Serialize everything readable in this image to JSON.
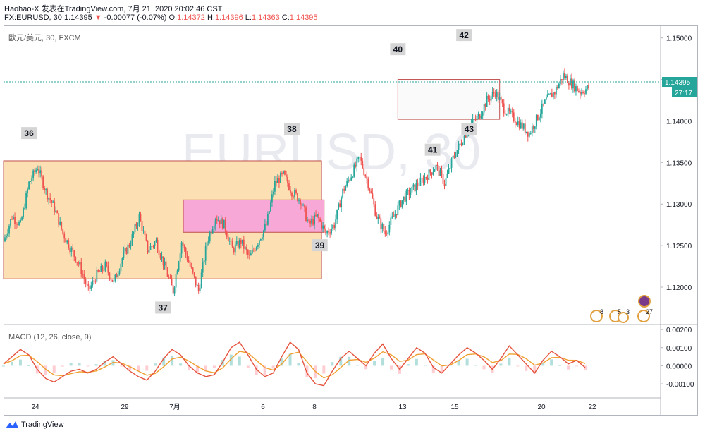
{
  "header": {
    "line1": "Haohao-X 发表在TradingView.com, 7月 21, 2020 20:02:46 CST",
    "symbol_line": "FX:EURUSD, 30 1.14395",
    "change_arrow": "▼",
    "change": "-0.00077 (-0.07%)",
    "o_label": "O:",
    "o_value": "1.14372",
    "h_label": "H:",
    "h_value": "1.14396",
    "l_label": "L:",
    "l_value": "1.14363",
    "c_label": "C:",
    "c_value": "1.14395"
  },
  "pane_symbol": "欧元/美元, 30, FXCM",
  "watermark": "EURUSD, 30",
  "macd_label": "MACD (12, 26, close, 9)",
  "brand": "TradingView",
  "price_badge": "1.14395",
  "timer_badge": "27:17",
  "event_badges": [
    "8",
    "5",
    "3",
    "27"
  ],
  "colors": {
    "up": "#26a69a",
    "down": "#ef5350",
    "zone_orange": "#fddfb4",
    "zone_pink": "#f7a8d6",
    "zone_box": "#fafafa",
    "zone_border": "#c0504d",
    "macd_line": "#e5533d",
    "signal_line": "#f0a030",
    "price_line": "#26a69a"
  },
  "chart_data": [
    {
      "type": "candlestick",
      "title": "",
      "x_ticks": [
        "24",
        "29",
        "7月",
        "6",
        "8",
        "13",
        "15",
        "20",
        "22"
      ],
      "y_ticks": [
        1.15,
        1.145,
        1.14,
        1.135,
        1.13,
        1.125,
        1.12
      ],
      "y_tick_labels": [
        "1.15000",
        "1.14500",
        "1.14000",
        "1.13500",
        "1.13000",
        "1.12500",
        "1.12000"
      ],
      "ylim": [
        1.1155,
        1.1515
      ],
      "last_price": 1.14395,
      "price_path": [
        [
          0,
          1.1255
        ],
        [
          1,
          1.1285
        ],
        [
          2,
          1.1275
        ],
        [
          3,
          1.1325
        ],
        [
          4,
          1.1345
        ],
        [
          5,
          1.1315
        ],
        [
          6,
          1.1295
        ],
        [
          7,
          1.1265
        ],
        [
          8,
          1.1245
        ],
        [
          9,
          1.1225
        ],
        [
          10,
          1.1195
        ],
        [
          11,
          1.1215
        ],
        [
          12,
          1.1225
        ],
        [
          13,
          1.1205
        ],
        [
          14,
          1.1235
        ],
        [
          15,
          1.1255
        ],
        [
          16,
          1.1285
        ],
        [
          17,
          1.1245
        ],
        [
          18,
          1.1255
        ],
        [
          19,
          1.1225
        ],
        [
          20,
          1.1195
        ],
        [
          21,
          1.1255
        ],
        [
          22,
          1.1225
        ],
        [
          23,
          1.1195
        ],
        [
          24,
          1.1255
        ],
        [
          25,
          1.1285
        ],
        [
          26,
          1.1275
        ],
        [
          27,
          1.1245
        ],
        [
          28,
          1.1255
        ],
        [
          29,
          1.1235
        ],
        [
          30,
          1.1255
        ],
        [
          31,
          1.1275
        ],
        [
          32,
          1.1325
        ],
        [
          33,
          1.1335
        ],
        [
          34,
          1.1315
        ],
        [
          35,
          1.1305
        ],
        [
          36,
          1.1275
        ],
        [
          37,
          1.1285
        ],
        [
          38,
          1.1265
        ],
        [
          39,
          1.1275
        ],
        [
          40,
          1.1315
        ],
        [
          41,
          1.1335
        ],
        [
          42,
          1.1355
        ],
        [
          43,
          1.1325
        ],
        [
          44,
          1.1285
        ],
        [
          45,
          1.1265
        ],
        [
          46,
          1.1285
        ],
        [
          47,
          1.1305
        ],
        [
          48,
          1.1315
        ],
        [
          49,
          1.1325
        ],
        [
          50,
          1.1335
        ],
        [
          51,
          1.1345
        ],
        [
          52,
          1.1325
        ],
        [
          53,
          1.1355
        ],
        [
          54,
          1.1375
        ],
        [
          55,
          1.1395
        ],
        [
          56,
          1.1405
        ],
        [
          57,
          1.1425
        ],
        [
          58,
          1.1435
        ],
        [
          59,
          1.1415
        ],
        [
          60,
          1.1405
        ],
        [
          61,
          1.1395
        ],
        [
          62,
          1.1385
        ],
        [
          63,
          1.1405
        ],
        [
          64,
          1.1425
        ],
        [
          65,
          1.1435
        ],
        [
          66,
          1.1455
        ],
        [
          67,
          1.1445
        ],
        [
          68,
          1.1435
        ],
        [
          69,
          1.144
        ]
      ],
      "zones": [
        {
          "name": "orange-range",
          "from": 0,
          "to": 37.5,
          "low": 1.121,
          "high": 1.1352,
          "fill": "#fddfb4"
        },
        {
          "name": "pink-range",
          "from": 21.2,
          "to": 37.8,
          "low": 1.1266,
          "high": 1.1305,
          "fill": "#f7a8d6"
        },
        {
          "name": "top-range",
          "from": 46.5,
          "to": 58.5,
          "low": 1.1402,
          "high": 1.145,
          "fill": "#fafafa"
        }
      ],
      "annotations": [
        {
          "text": "36",
          "x": 3,
          "y": 1.1385
        },
        {
          "text": "37",
          "x": 18.8,
          "y": 1.1175
        },
        {
          "text": "38",
          "x": 34,
          "y": 1.139
        },
        {
          "text": "39",
          "x": 37.3,
          "y": 1.125
        },
        {
          "text": "40",
          "x": 46.5,
          "y": 1.1486
        },
        {
          "text": "41",
          "x": 50.6,
          "y": 1.1365
        },
        {
          "text": "42",
          "x": 54.3,
          "y": 1.1503
        },
        {
          "text": "43",
          "x": 54.9,
          "y": 1.139
        }
      ]
    },
    {
      "type": "macd",
      "title": "MACD (12, 26, close, 9)",
      "y_ticks": [
        0.002,
        0.001,
        0.0,
        -0.001
      ],
      "y_tick_labels": [
        "0.00200",
        "0.00100",
        "0.00000",
        "-0.00100"
      ],
      "ylim": [
        -0.0017,
        0.0022
      ],
      "macd": [
        0.0001,
        0.0005,
        0.0009,
        0.0006,
        -0.0002,
        -0.0007,
        -0.0009,
        -0.0006,
        -0.0003,
        -0.0002,
        -0.0004,
        -0.0002,
        0.0002,
        0.0005,
        0.0001,
        -0.0003,
        -0.0006,
        -0.0008,
        -0.0003,
        0.0004,
        0.0009,
        0.0006,
        0.0,
        -0.0004,
        -0.0006,
        -0.0005,
        0.0002,
        0.001,
        0.0013,
        0.0006,
        -0.0002,
        -0.0006,
        -0.0004,
        0.0005,
        0.0013,
        0.0009,
        -0.0004,
        -0.001,
        -0.0011,
        -0.0003,
        0.0004,
        0.0008,
        0.0004,
        0.0,
        0.0007,
        0.0012,
        0.0004,
        -0.0002,
        0.0004,
        0.001,
        0.0007,
        -0.0001,
        -0.0004,
        0.0001,
        0.0006,
        0.001,
        0.0007,
        0.0003,
        -0.0002,
        0.0004,
        0.0011,
        0.0006,
        0.0001,
        -0.0004,
        0.0003,
        0.0008,
        0.0005,
        0.0001,
        0.0003,
        -0.0001
      ]
    }
  ]
}
